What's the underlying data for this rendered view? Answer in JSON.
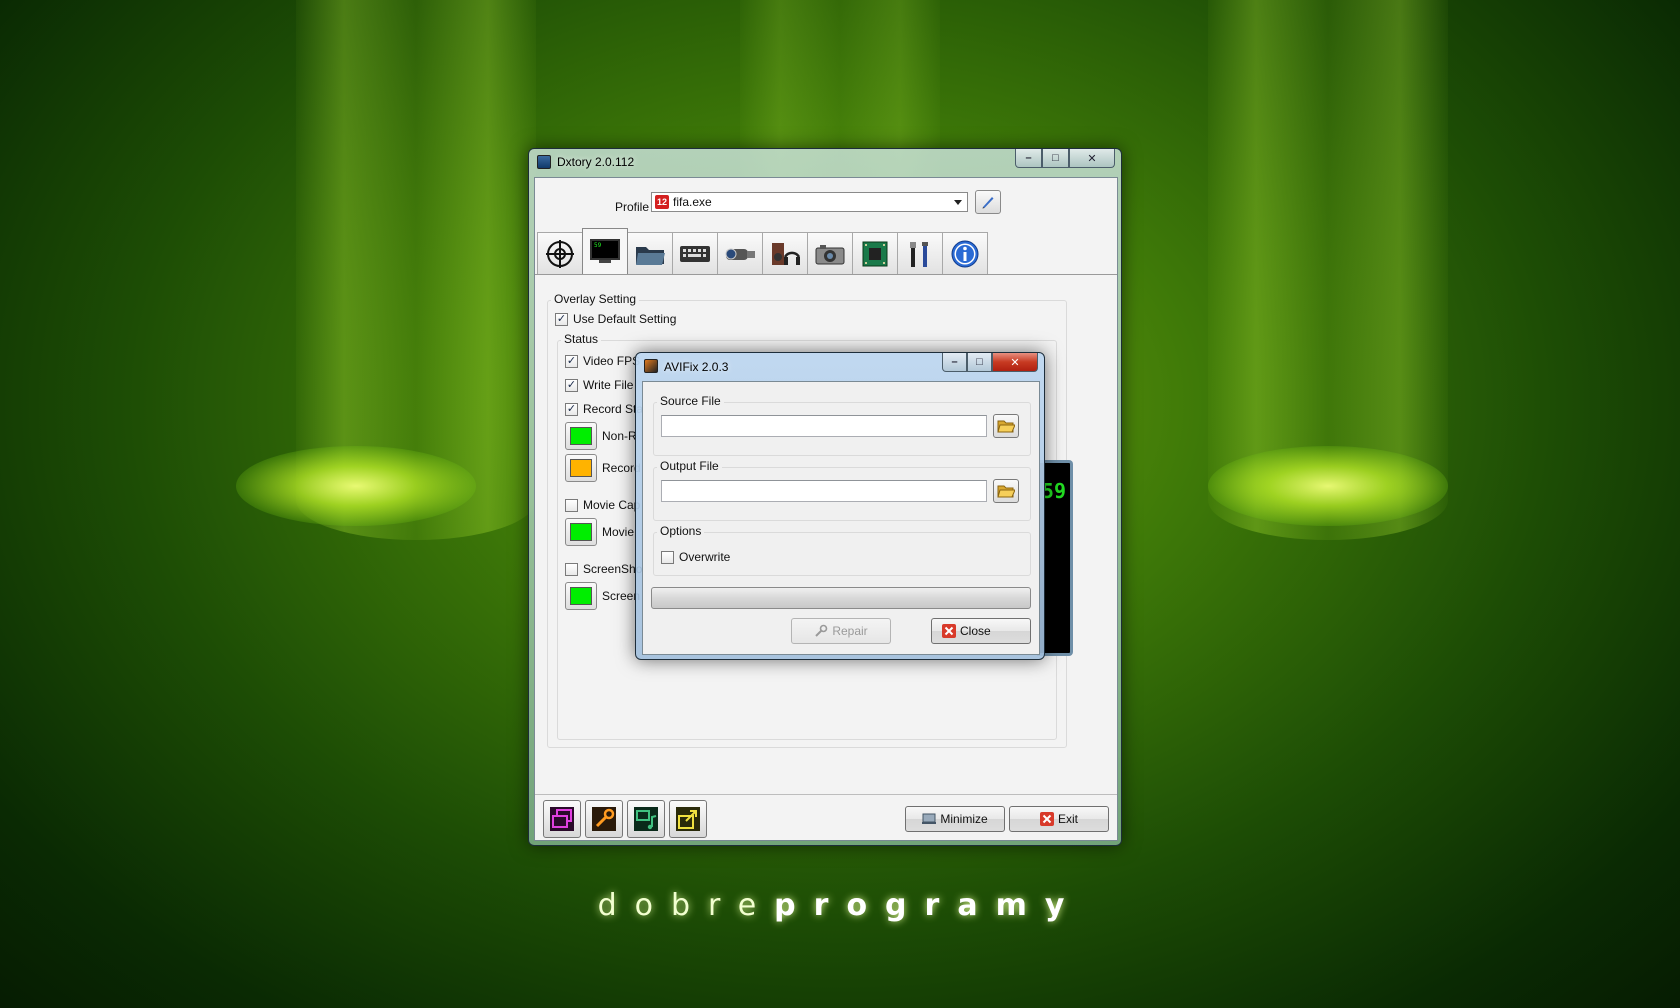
{
  "wallpaper": {
    "brand_regular": "dobre",
    "brand_bold": "programy",
    "accent": "#6f9f10"
  },
  "dxtory": {
    "title": "Dxtory 2.0.112",
    "caption": {
      "minimize": "–",
      "maximize": "□",
      "close": "✕"
    },
    "profile_label": "Profile",
    "profile_value": "fifa.exe",
    "profile_badge": "12",
    "tabs": [
      {
        "icon": "crosshair-icon",
        "active": false
      },
      {
        "icon": "monitor-icon",
        "active": true
      },
      {
        "icon": "folder-icon",
        "active": false
      },
      {
        "icon": "keyboard-icon",
        "active": false
      },
      {
        "icon": "camcorder-icon",
        "active": false
      },
      {
        "icon": "audio-icon",
        "active": false
      },
      {
        "icon": "camera-icon",
        "active": false
      },
      {
        "icon": "chip-icon",
        "active": false
      },
      {
        "icon": "tools-icon",
        "active": false
      },
      {
        "icon": "info-icon",
        "active": false
      }
    ],
    "overlay_group_label": "Overlay Setting",
    "use_default_label": "Use Default Setting",
    "use_default_checked": true,
    "status_group_label": "Status",
    "status_items": [
      {
        "label": "Video FPS",
        "checked": true
      },
      {
        "label": "Write File",
        "checked": true
      },
      {
        "label": "Record Sta",
        "checked": true
      }
    ],
    "colors": [
      {
        "label": "Non-R",
        "color": "#00ee00"
      },
      {
        "label": "Record",
        "color": "#ffb300"
      }
    ],
    "movie_capture_label": "Movie Cap",
    "movie_capture_checked": false,
    "movie_color": {
      "label": "Movie",
      "color": "#00ee00"
    },
    "screenshot_label": "ScreenSho",
    "screenshot_checked": false,
    "screenshot_color": {
      "label": "Screen",
      "color": "#00ee00"
    },
    "preview_text": "59",
    "bottom_tools": [
      "windows-icon",
      "wrench-icon",
      "music-screen-icon",
      "export-icon"
    ],
    "minimize_label": "Minimize",
    "exit_label": "Exit"
  },
  "avifix": {
    "title": "AVIFix 2.0.3",
    "caption": {
      "minimize": "–",
      "maximize": "□",
      "close": "✕"
    },
    "source_label": "Source File",
    "source_value": "",
    "output_label": "Output File",
    "output_value": "",
    "options_label": "Options",
    "overwrite_label": "Overwrite",
    "overwrite_checked": false,
    "progress": 0,
    "repair_label": "Repair",
    "close_label": "Close"
  }
}
